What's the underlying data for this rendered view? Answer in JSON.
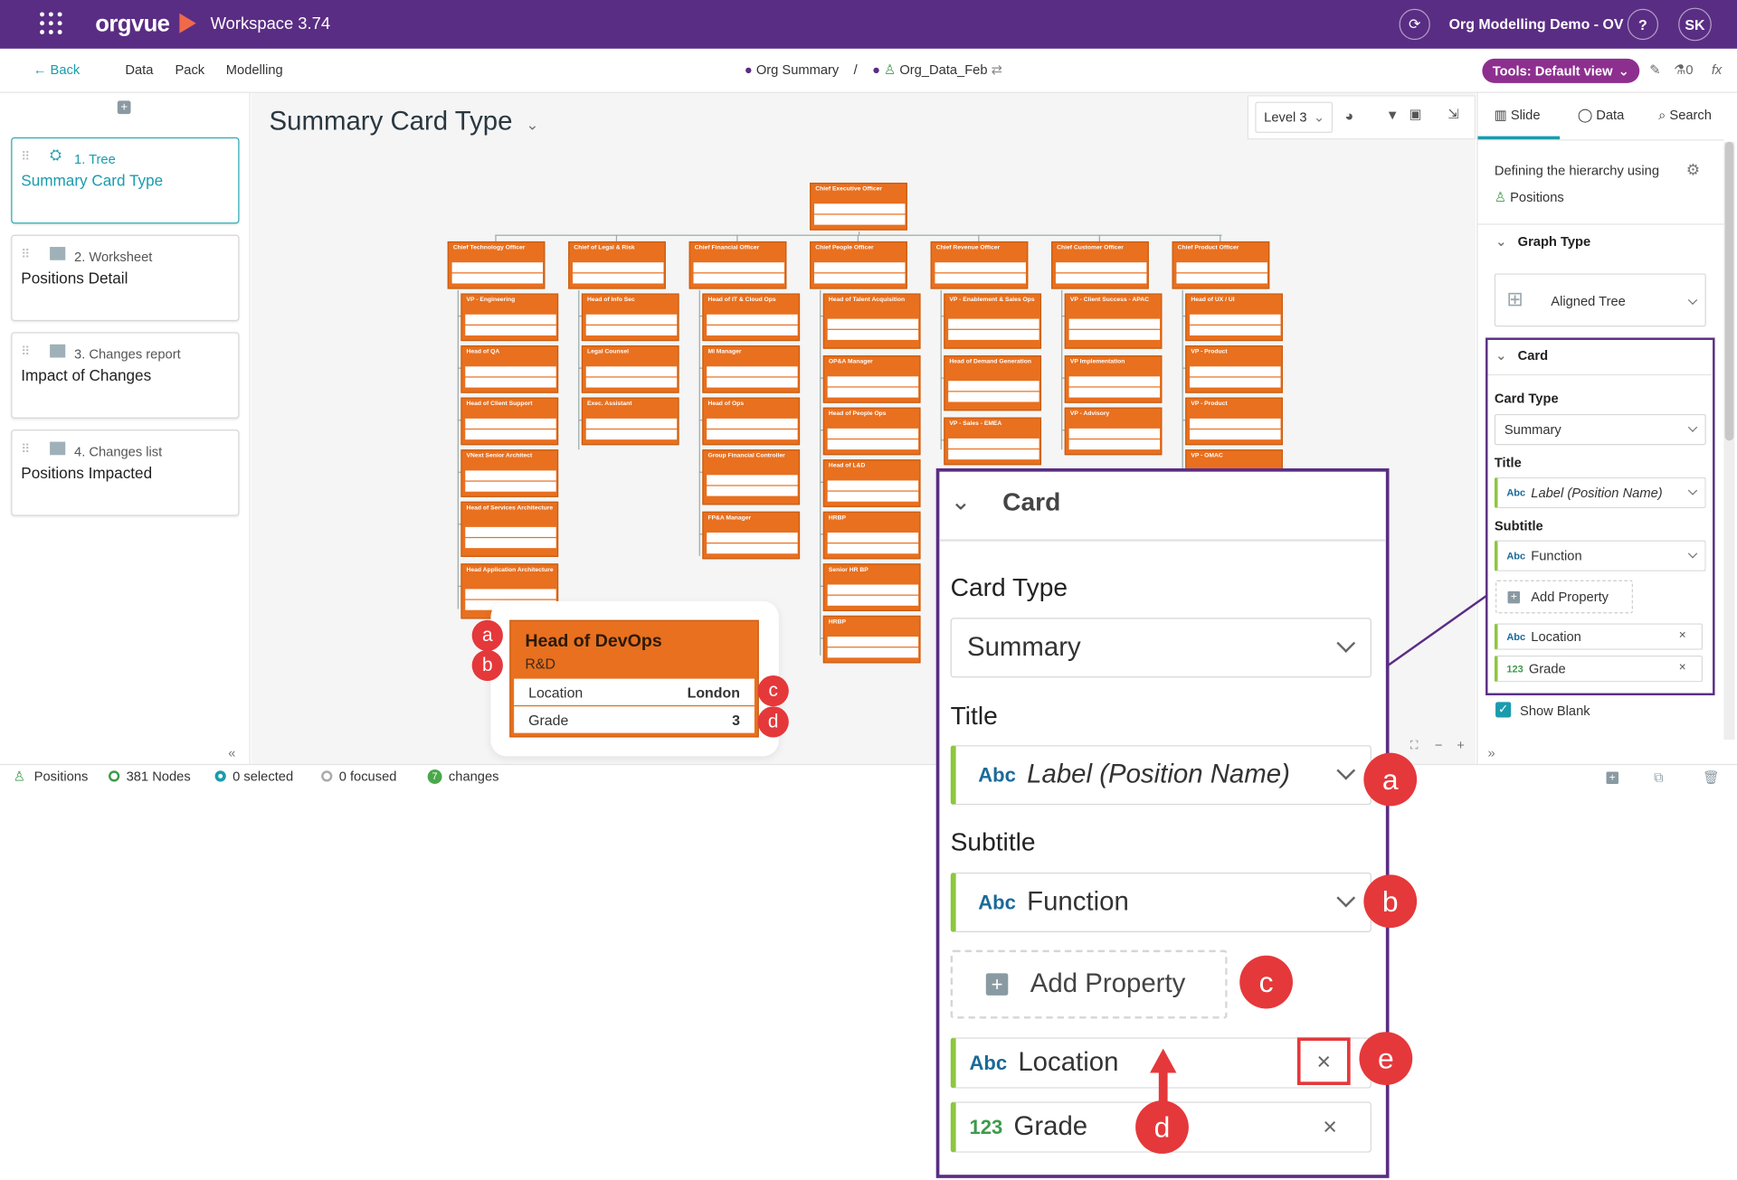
{
  "topbar": {
    "product": "orgvue",
    "workspace": "Workspace 3.74",
    "dataset": "Org Modelling Demo - OV",
    "help": "?",
    "user": "SK"
  },
  "subbar": {
    "back": "Back",
    "menu": [
      "Data",
      "Pack",
      "Modelling"
    ],
    "crumb1": "Org Summary",
    "separator": "/",
    "crumb2": "Org_Data_Feb",
    "tools": "Tools: Default view",
    "count": "0",
    "fx": "fx"
  },
  "slides": [
    {
      "num": "1. Tree",
      "title": "Summary Card Type"
    },
    {
      "num": "2. Worksheet",
      "title": "Positions Detail"
    },
    {
      "num": "3. Changes report",
      "title": "Impact of Changes"
    },
    {
      "num": "4. Changes list",
      "title": "Positions Impacted"
    }
  ],
  "canvas": {
    "title": "Summary Card Type",
    "level": "Level 3"
  },
  "org": {
    "root": "Chief Executive Officer",
    "columns": [
      {
        "head": "Chief Technology Officer",
        "children": [
          "VP - Engineering",
          "Head of QA",
          "Head of Client Support",
          "VNext Senior Architect",
          "Head of Services Architecture",
          "Head Application Architecture"
        ]
      },
      {
        "head": "Chief of Legal & Risk",
        "children": [
          "Head of Info Sec",
          "Legal Counsel",
          "Exec. Assistant"
        ]
      },
      {
        "head": "Chief Financial Officer",
        "children": [
          "Head of IT & Cloud Ops",
          "MI Manager",
          "Head of Ops",
          "Group Financial Controller",
          "FP&A Manager"
        ]
      },
      {
        "head": "Chief People Officer",
        "children": [
          "Head of Talent Acquisition",
          "OP&A Manager",
          "Head of People Ops",
          "Head of L&D",
          "HRBP",
          "Senior HR BP",
          "HRBP"
        ]
      },
      {
        "head": "Chief Revenue Officer",
        "children": [
          "VP - Enablement & Sales Ops",
          "Head of Demand Generation",
          "VP - Sales - EMEA"
        ]
      },
      {
        "head": "Chief Customer Officer",
        "children": [
          "VP - Client Success - APAC",
          "VP Implementation",
          "VP - Advisory"
        ]
      },
      {
        "head": "Chief Product Officer",
        "children": [
          "Head of UX / UI",
          "VP - Product",
          "VP - Product",
          "VP - OMAC"
        ]
      }
    ]
  },
  "example_card": {
    "title": "Head of DevOps",
    "subtitle": "R&D",
    "row1_label": "Location",
    "row1_value": "London",
    "row2_label": "Grade",
    "row2_value": "3"
  },
  "badges": {
    "a": "a",
    "b": "b",
    "c": "c",
    "d": "d",
    "e": "e"
  },
  "right_panel": {
    "tabs": [
      "Slide",
      "Data",
      "Search"
    ],
    "hierarchy_label": "Defining the hierarchy using",
    "hierarchy_value": "Positions",
    "graph_type_label": "Graph Type",
    "graph_type_value": "Aligned Tree",
    "card_label": "Card",
    "card_type_label": "Card Type",
    "card_type_value": "Summary",
    "title_label": "Title",
    "title_value": "Label (Position Name)",
    "subtitle_label": "Subtitle",
    "subtitle_value": "Function",
    "add_property": "Add Property",
    "prop1": "Location",
    "prop2": "Grade",
    "show_blank": "Show Blank",
    "abc": "Abc",
    "num": "123"
  },
  "bottombar": {
    "positions": "Positions",
    "nodes": "381 Nodes",
    "selected": "0 selected",
    "focused": "0 focused",
    "changes": "changes",
    "changes_count": "7"
  },
  "colors": {
    "brand": "#5a2d84",
    "card": "#e8701f",
    "accent": "#1a9cad",
    "badge": "#e5383b",
    "tools": "#8d2f8f",
    "green": "#8dc63f"
  }
}
